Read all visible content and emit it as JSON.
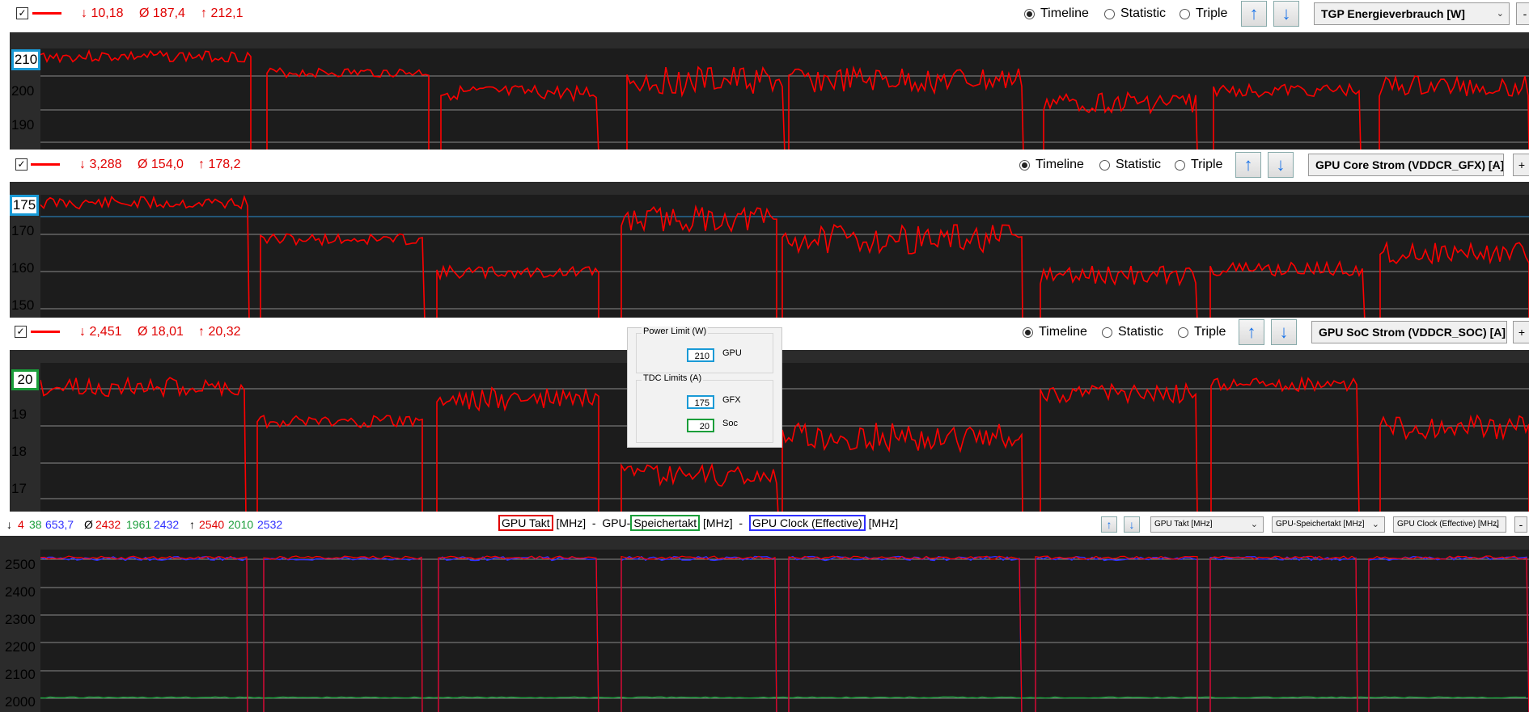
{
  "panels": [
    {
      "stats": {
        "min": "↓ 10,18",
        "avg": "Ø 187,4",
        "max": "↑ 212,1"
      },
      "radio": {
        "timeline": "Timeline",
        "statistic": "Statistic",
        "triple": "Triple",
        "selected": "timeline"
      },
      "sensor": "TGP Energieverbrauch [W]",
      "y_labels": [
        "210",
        "200",
        "190"
      ],
      "highlight": "210"
    },
    {
      "stats": {
        "min": "↓ 3,288",
        "avg": "Ø 154,0",
        "max": "↑ 178,2"
      },
      "radio": {
        "timeline": "Timeline",
        "statistic": "Statistic",
        "triple": "Triple",
        "selected": "timeline"
      },
      "sensor": "GPU Core Strom (VDDCR_GFX) [A]",
      "y_labels": [
        "175",
        "170",
        "160",
        "150"
      ],
      "highlight": "175"
    },
    {
      "stats": {
        "min": "↓ 2,451",
        "avg": "Ø 18,01",
        "max": "↑ 20,32"
      },
      "radio": {
        "timeline": "Timeline",
        "statistic": "Statistic",
        "triple": "Triple",
        "selected": "timeline"
      },
      "sensor": "GPU SoC Strom (VDDCR_SOC) [A]",
      "y_labels": [
        "20",
        "19",
        "18",
        "17"
      ],
      "highlight": "20"
    }
  ],
  "clock_panel": {
    "stats": {
      "min_arrow": "↓",
      "min": [
        "4",
        "38",
        "653,7"
      ],
      "avg_symbol": "Ø",
      "avg": [
        "2432",
        "1961",
        "2432"
      ],
      "max_arrow": "↑",
      "max": [
        "2540",
        "2010",
        "2532"
      ]
    },
    "legend": {
      "s1": "GPU Takt",
      "u1": " [MHz]  -  GPU-",
      "s2": "Speichertakt",
      "u2": " [MHz]  -  ",
      "s3": "GPU Clock (Effective)",
      "u3": " [MHz]"
    },
    "selects": [
      "GPU Takt [MHz]",
      "GPU-Speichertakt [MHz]",
      "GPU Clock (Effective) [MHz]"
    ],
    "y_labels": [
      "2500",
      "2400",
      "2300",
      "2200",
      "2100",
      "2000"
    ]
  },
  "dialog": {
    "power_title": "Power Limit (W)",
    "power_value": "210",
    "power_label": "GPU",
    "tdc_title": "TDC Limits (A)",
    "gfx_value": "175",
    "gfx_label": "GFX",
    "soc_value": "20",
    "soc_label": "Soc"
  },
  "checkbox_mark": "✓",
  "plus_label": "+",
  "minus_label": "-",
  "colors": {
    "series": "#ff0000",
    "gpu_takt": "#ff0000",
    "speicher": "#1a9e3a",
    "effective": "#3030ff",
    "highlight": "#1a9ad6"
  },
  "icons": {
    "up": "arrow-up-icon",
    "down": "arrow-down-icon",
    "check": "checkbox-check-icon"
  }
}
